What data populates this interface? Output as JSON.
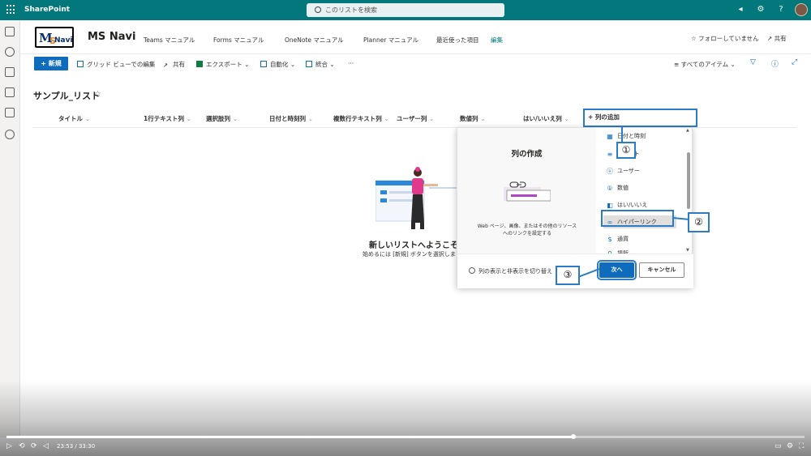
{
  "suitebar": {
    "app_name": "SharePoint",
    "search_placeholder": "このリストを検索"
  },
  "site": {
    "logo_letter": "M",
    "logo_s": "S",
    "logo_navi": "Navi",
    "title": "MS Navi",
    "nav": [
      "Teams マニュアル",
      "Forms マニュアル",
      "OneNote マニュアル",
      "Planner マニュアル",
      "最近使った項目"
    ],
    "edit_link": "編集",
    "follow": "☆ フォローしていません",
    "share": "共有"
  },
  "commandbar": {
    "new": "+ 新規",
    "grid_edit": "グリッド ビューでの編集",
    "share": "共有",
    "export": "エクスポート",
    "automate": "自動化",
    "integrate": "統合",
    "more": "···",
    "view": "すべてのアイテム"
  },
  "list": {
    "title": "サンプル_リスト",
    "columns": [
      "タイトル",
      "1行テキスト列",
      "選択肢列",
      "日付と時刻列",
      "複数行テキスト列",
      "ユーザー列",
      "数値列",
      "はい/いいえ列"
    ],
    "add_column": "+ 列の追加",
    "welcome": "新しいリストへようこそ",
    "welcome_sub": "始めるには [新規] ボタンを選択しま"
  },
  "panel": {
    "title": "列の作成",
    "description": "Web ページ、画像、またはその他のリソースへのリンクを設定する",
    "types": [
      "日付と時刻",
      "テキスト",
      "ユーザー",
      "数値",
      "はい/いいえ",
      "ハイパーリンク",
      "通貨",
      "場所"
    ],
    "selected_type": "ハイパーリンク",
    "toggle_link": "列の表示と非表示を切り替え",
    "next": "次へ",
    "cancel": "キャンセル"
  },
  "annotations": {
    "step1": "①",
    "step2": "②",
    "step3": "③"
  },
  "video": {
    "time": "23:53 / 33:30",
    "progress": 0.71
  },
  "colors": {
    "suitebar": "#03787c",
    "primary": "#0f6cbd",
    "annotation": "#2b7cc4"
  }
}
